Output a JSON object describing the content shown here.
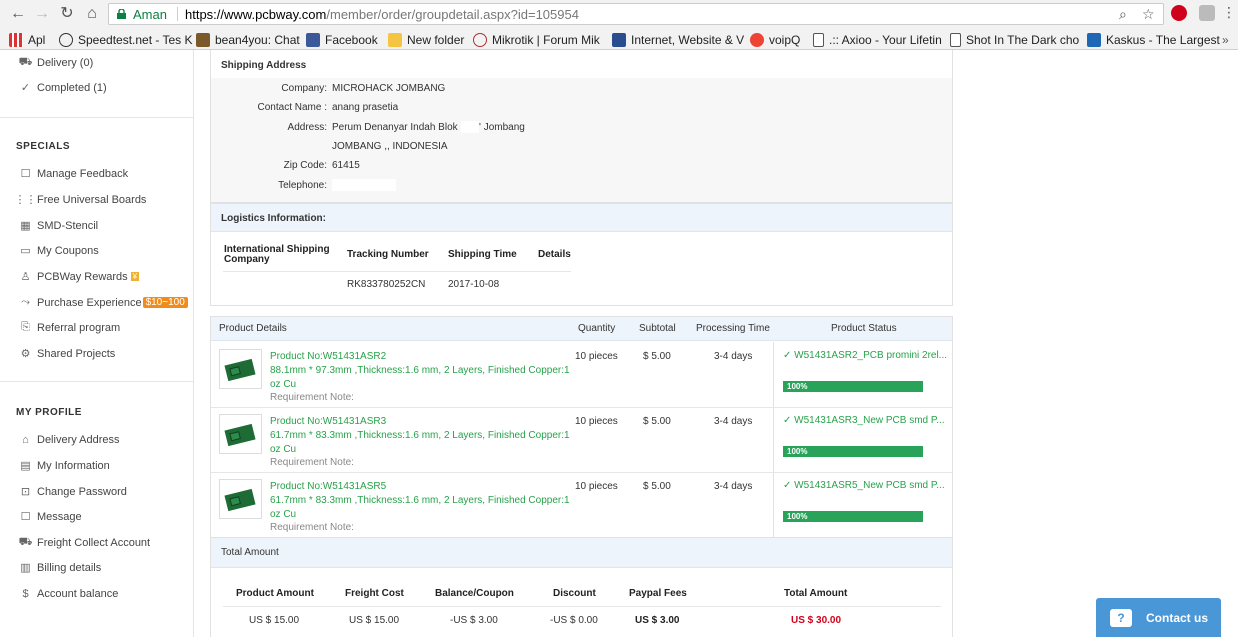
{
  "browser": {
    "secure_label": "Aman",
    "url_host": "https://www.pcbway.com",
    "url_path": "/member/order/groupdetail.aspx?id=105954",
    "bookmarks": [
      {
        "label": "Apl",
        "icon": "apps-grid-icon"
      },
      {
        "label": "Speedtest.net - Tes K",
        "icon": "speedtest-icon"
      },
      {
        "label": "bean4you: Chat",
        "icon": "bean4you-icon"
      },
      {
        "label": "Facebook",
        "icon": "facebook-icon"
      },
      {
        "label": "New folder",
        "icon": "folder-icon"
      },
      {
        "label": "Mikrotik | Forum Mik",
        "icon": "mikrotik-icon"
      },
      {
        "label": "Internet, Website & V",
        "icon": "site-icon"
      },
      {
        "label": "voipQ",
        "icon": "voipq-icon"
      },
      {
        "label": ".:: Axioo - Your Lifetin",
        "icon": "page-icon"
      },
      {
        "label": "Shot In The Dark cho",
        "icon": "page-icon"
      },
      {
        "label": "Kaskus - The Largest",
        "icon": "kaskus-icon"
      }
    ]
  },
  "sidebar": {
    "orders": [
      {
        "label": "Delivery (0)"
      },
      {
        "label": "Completed (1)"
      }
    ],
    "specials_heading": "SPECIALS",
    "specials": [
      {
        "label": "Manage Feedback"
      },
      {
        "label": "Free Universal Boards"
      },
      {
        "label": "SMD-Stencil"
      },
      {
        "label": "My Coupons"
      },
      {
        "label": "PCBWay Rewards",
        "badge": "¥"
      },
      {
        "label": "Purchase Experience",
        "badge": "$10~100"
      },
      {
        "label": "Referral program"
      },
      {
        "label": "Shared Projects"
      }
    ],
    "profile_heading": "MY PROFILE",
    "profile": [
      {
        "label": "Delivery Address"
      },
      {
        "label": "My Information"
      },
      {
        "label": "Change Password"
      },
      {
        "label": "Message"
      },
      {
        "label": "Freight Collect Account"
      },
      {
        "label": "Billing details"
      },
      {
        "label": "Account balance"
      }
    ]
  },
  "shipping": {
    "heading": "Shipping Address",
    "fields": [
      {
        "label": "Company:",
        "value": "MICROHACK JOMBANG"
      },
      {
        "label": "Contact Name :",
        "value": "anang prasetia"
      },
      {
        "label": "Address:",
        "value": "Perum Denanyar Indah Blok",
        "value2": "' Jombang",
        "value3": "JOMBANG ,, INDONESIA"
      },
      {
        "label": "Zip Code:",
        "value": "61415"
      },
      {
        "label": "Telephone:",
        "value": ""
      }
    ]
  },
  "logistics": {
    "heading": "Logistics Information:",
    "columns": [
      "International Shipping Company",
      "Tracking Number",
      "Shipping Time",
      "Details"
    ],
    "rows": [
      {
        "company": "",
        "tracking": "RK833780252CN",
        "time": "2017-10-08",
        "details": ""
      }
    ]
  },
  "products": {
    "columns": [
      "Product Details",
      "Quantity",
      "Subtotal",
      "Processing Time",
      "Product Status"
    ],
    "requirement_label": "Requirement Note:",
    "items": [
      {
        "no": "Product No:W51431ASR2",
        "spec": "88.1mm * 97.3mm ,Thickness:1.6 mm, 2 Layers, Finished Copper:1",
        "spec2": "oz Cu",
        "qty": "10 pieces",
        "subtotal": "$ 5.00",
        "processing": "3-4 days",
        "status": "W51431ASR2_PCB promini 2rel...",
        "progress": "100%"
      },
      {
        "no": "Product No:W51431ASR3",
        "spec": "61.7mm * 83.3mm ,Thickness:1.6 mm, 2 Layers, Finished Copper:1",
        "spec2": "oz Cu",
        "qty": "10 pieces",
        "subtotal": "$ 5.00",
        "processing": "3-4 days",
        "status": "W51431ASR3_New PCB smd P...",
        "progress": "100%"
      },
      {
        "no": "Product No:W51431ASR5",
        "spec": "61.7mm * 83.3mm ,Thickness:1.6 mm, 2 Layers, Finished Copper:1",
        "spec2": "oz Cu",
        "qty": "10 pieces",
        "subtotal": "$ 5.00",
        "processing": "3-4 days",
        "status": "W51431ASR5_New PCB smd P...",
        "progress": "100%"
      }
    ]
  },
  "total": {
    "heading": "Total Amount",
    "columns": [
      "Product Amount",
      "Freight Cost",
      "Balance/Coupon",
      "Discount",
      "Paypal Fees",
      "Total Amount"
    ],
    "values": [
      "US $ 15.00",
      "US $ 15.00",
      "-US $ 3.00",
      "-US $ 0.00",
      "US $ 3.00",
      "US $ 30.00"
    ]
  },
  "contact": {
    "label": "Contact us"
  },
  "colors": {
    "green": "#27a24a",
    "accent_blue": "#4a97d8",
    "red_total": "#d0021b"
  }
}
